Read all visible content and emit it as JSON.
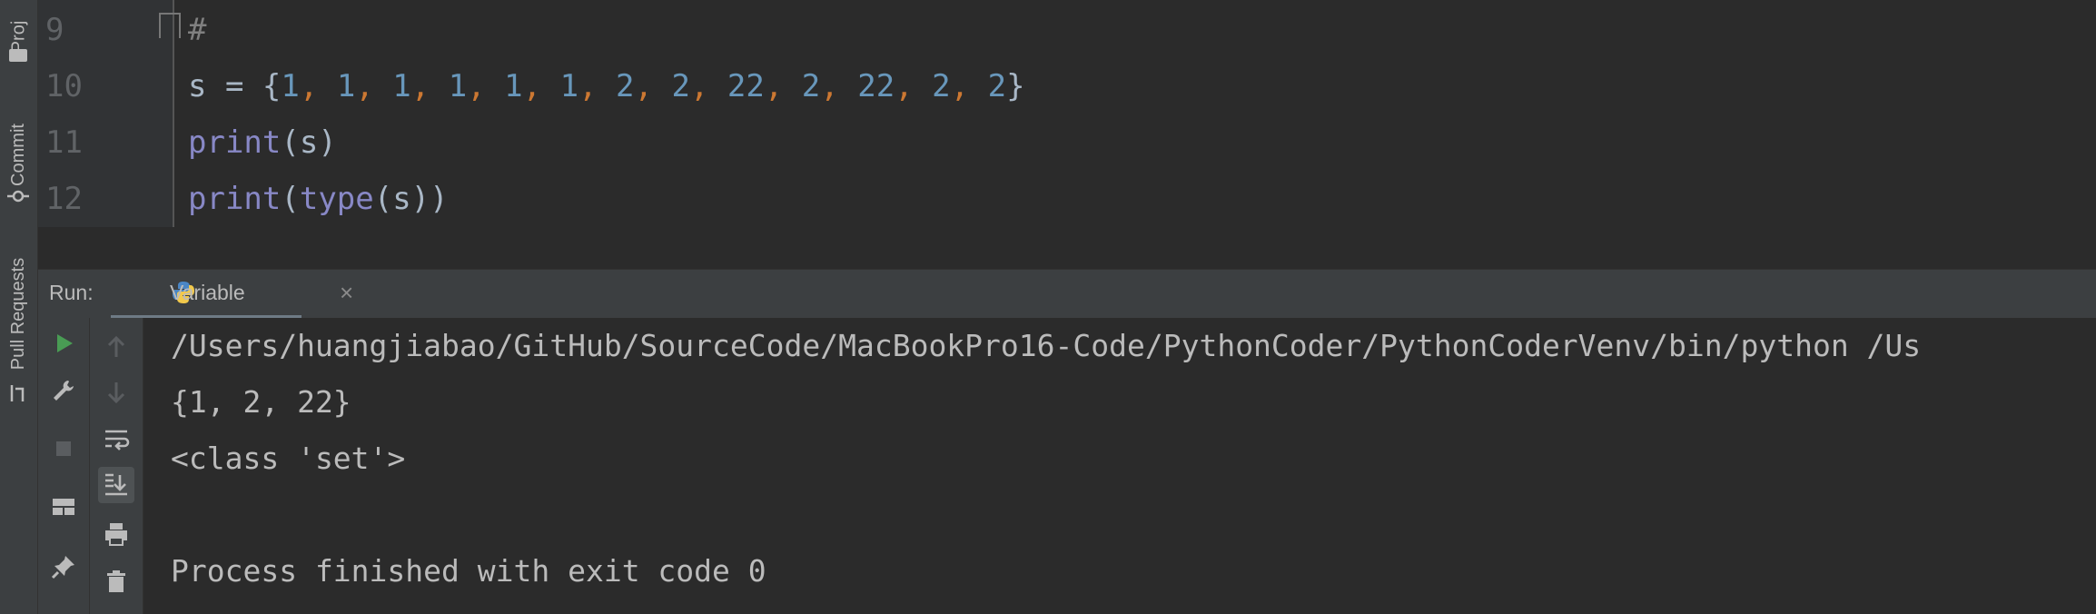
{
  "side_tabs": {
    "project": "Proj",
    "commit": "Commit",
    "pull_requests": "Pull Requests"
  },
  "editor": {
    "lines": [
      {
        "number": "9",
        "text": "#"
      },
      {
        "number": "10"
      },
      {
        "number": "11"
      },
      {
        "number": "12"
      }
    ],
    "line10": {
      "var": "s",
      "op": " = ",
      "open": "{",
      "close": "}",
      "elements": [
        "1",
        "1",
        "1",
        "1",
        "1",
        "1",
        "2",
        "2",
        "22",
        "2",
        "22",
        "2",
        "2"
      ],
      "sep": ", "
    },
    "line11": {
      "fn": "print",
      "args": "(s)"
    },
    "line12": {
      "fn": "print",
      "paren_open": "(",
      "fn2": "type",
      "args": "(s))"
    }
  },
  "run_panel": {
    "label": "Run:",
    "tab_label": "Variable",
    "close": "×"
  },
  "console": {
    "lines": [
      "/Users/huangjiabao/GitHub/SourceCode/MacBookPro16-Code/PythonCoder/PythonCoderVenv/bin/python /Us",
      "{1, 2, 22}",
      "<class 'set'>",
      "",
      "Process finished with exit code 0"
    ]
  },
  "colors": {
    "background": "#2b2b2b",
    "number": "#6897bb",
    "comma": "#cc7832",
    "builtin": "#8888c6",
    "text": "#a9b7c6",
    "run_green": "#499c54"
  },
  "icons": {
    "run": "run-icon",
    "wrench": "wrench-icon",
    "stop": "stop-icon",
    "layout": "layout-icon",
    "pin": "pin-icon",
    "up": "up-arrow-icon",
    "down": "down-arrow-icon",
    "soft_wrap": "soft-wrap-icon",
    "scroll_end": "scroll-to-end-icon",
    "print": "print-icon",
    "trash": "trash-icon"
  }
}
